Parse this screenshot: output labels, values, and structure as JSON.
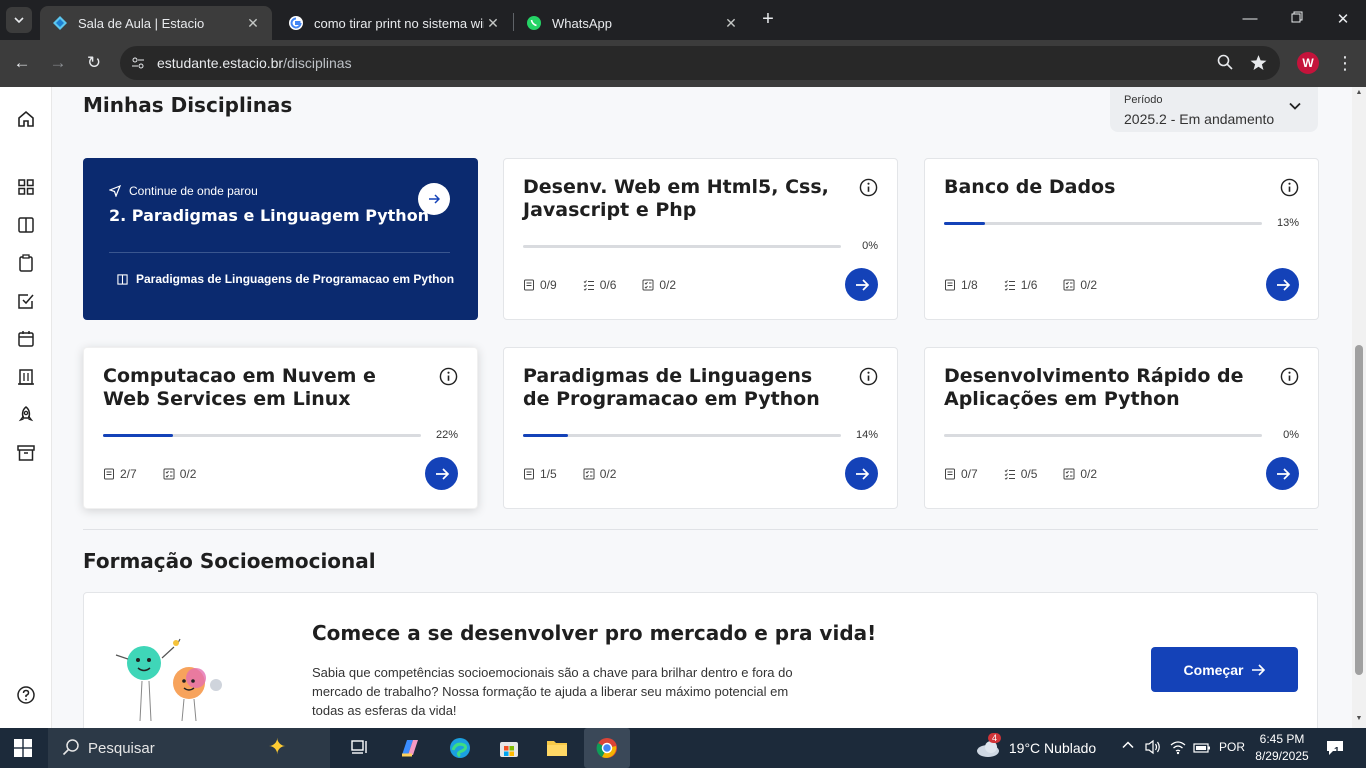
{
  "browser": {
    "tabs": [
      {
        "title": "Sala de Aula | Estacio",
        "active": true
      },
      {
        "title": "como tirar print no sistema win",
        "active": false
      },
      {
        "title": "WhatsApp",
        "active": false
      }
    ],
    "url_host": "estudante.estacio.br",
    "url_path": "/disciplinas",
    "profile_initial": "W"
  },
  "rail": {
    "icons": [
      "home-icon",
      "grid-icon",
      "book-icon",
      "clipboard-icon",
      "check-square-icon",
      "calendar-icon",
      "building-icon",
      "rocket-icon",
      "archive-icon",
      "help-icon"
    ]
  },
  "page": {
    "section_title": "Minhas Disciplinas",
    "period": {
      "label": "Período",
      "value": "2025.2 - Em andamento"
    },
    "continue_card": {
      "label": "Continue de onde parou",
      "title": "2. Paradigmas e Linguagem Python",
      "subject": "Paradigmas de Linguagens de Programacao em Python"
    },
    "courses": [
      {
        "title": "Desenv. Web em Html5, Css, Javascript e Php",
        "progress": 0,
        "progress_label": "0%",
        "stats": [
          "0/9",
          "0/6",
          "0/2"
        ]
      },
      {
        "title": "Banco de Dados",
        "progress": 13,
        "progress_label": "13%",
        "stats": [
          "1/8",
          "1/6",
          "0/2"
        ]
      },
      {
        "title": "Computacao em Nuvem e Web Services em Linux",
        "progress": 22,
        "progress_label": "22%",
        "stats": [
          "2/7",
          "0/2"
        ]
      },
      {
        "title": "Paradigmas de Linguagens de Programacao em Python",
        "progress": 14,
        "progress_label": "14%",
        "stats": [
          "1/5",
          "0/2"
        ]
      },
      {
        "title": "Desenvolvimento Rápido de Aplicações em Python",
        "progress": 0,
        "progress_label": "0%",
        "stats": [
          "0/7",
          "0/5",
          "0/2"
        ]
      }
    ],
    "socio": {
      "section_title": "Formação Socioemocional",
      "title": "Comece a se desenvolver pro mercado e pra vida!",
      "text": "Sabia que competências socioemocionais são a chave para brilhar dentro e fora do mercado de trabalho? Nossa formação te ajuda a liberar seu máximo potencial em todas as esferas da vida!",
      "cta": "Começar"
    }
  },
  "taskbar": {
    "search_placeholder": "Pesquisar",
    "weather": "19°C  Nublado",
    "weather_badge": "4",
    "language": "POR",
    "time": "6:45 PM",
    "date": "8/29/2025",
    "notifications": "1"
  },
  "colors": {
    "accent": "#1442b8",
    "navy": "#0b2a6f",
    "chrome_dark": "#202124"
  }
}
